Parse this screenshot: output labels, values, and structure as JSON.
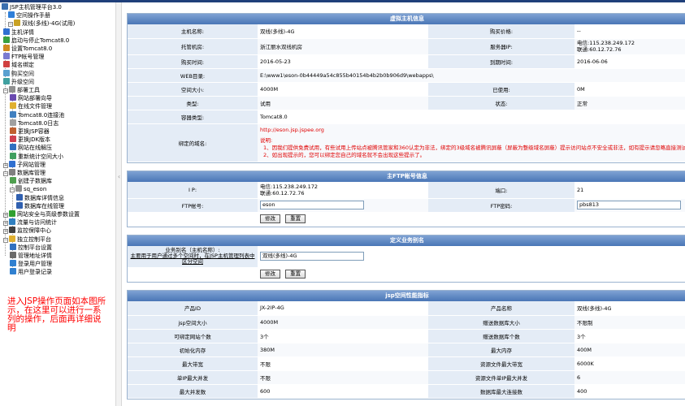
{
  "tree": {
    "items": [
      {
        "label": "JSP主机管理平台3.0",
        "level": 0,
        "icon": "computer-icon",
        "color": "#3a6fb0",
        "exp": ""
      },
      {
        "label": "空间操作手册",
        "level": 1,
        "icon": "book-icon",
        "color": "#2f7fd8",
        "exp": ""
      },
      {
        "label": "双线(多线)-4G(试用)",
        "level": 1,
        "icon": "server-icon",
        "color": "#c9a225",
        "exp": "−"
      },
      {
        "label": "主机详情",
        "level": 2,
        "icon": "info-icon",
        "color": "#2f6fd0",
        "exp": ""
      },
      {
        "label": "启动与停止Tomcat8.0",
        "level": 2,
        "icon": "power-icon",
        "color": "#3aa040",
        "exp": ""
      },
      {
        "label": "设置Tomcat8.0",
        "level": 2,
        "icon": "settings-icon",
        "color": "#d08a20",
        "exp": ""
      },
      {
        "label": "FTP帐号管理",
        "level": 2,
        "icon": "ftp-icon",
        "color": "#7a7ad0",
        "exp": ""
      },
      {
        "label": "域名绑定",
        "level": 2,
        "icon": "globe-icon",
        "color": "#d04040",
        "exp": ""
      },
      {
        "label": "购买空间",
        "level": 2,
        "icon": "cart-icon",
        "color": "#5aa0d0",
        "exp": ""
      },
      {
        "label": "升级空间",
        "level": 2,
        "icon": "upgrade-icon",
        "color": "#40a0a0",
        "exp": ""
      },
      {
        "label": "部署工具",
        "level": 2,
        "icon": "tools-icon",
        "color": "#909090",
        "exp": "−"
      },
      {
        "label": "网站部署向导",
        "level": 3,
        "icon": "wizard-icon",
        "color": "#6a4ab0",
        "exp": ""
      },
      {
        "label": "在线文件管理",
        "level": 3,
        "icon": "folder-icon",
        "color": "#e0b030",
        "exp": ""
      },
      {
        "label": "Tomcat8.0连接池",
        "level": 3,
        "icon": "pool-icon",
        "color": "#4080c0",
        "exp": ""
      },
      {
        "label": "Tomcat8.0日志",
        "level": 3,
        "icon": "log-icon",
        "color": "#a0a0a0",
        "exp": ""
      },
      {
        "label": "更换JSP容器",
        "level": 3,
        "icon": "container-icon",
        "color": "#c06030",
        "exp": ""
      },
      {
        "label": "更换JDK版本",
        "level": 3,
        "icon": "jdk-icon",
        "color": "#d04050",
        "exp": ""
      },
      {
        "label": "网站在线解压",
        "level": 3,
        "icon": "unzip-icon",
        "color": "#3070c0",
        "exp": ""
      },
      {
        "label": "重新统计空间大小",
        "level": 3,
        "icon": "stats-icon",
        "color": "#40a060",
        "exp": ""
      },
      {
        "label": "子网站管理",
        "level": 2,
        "icon": "subsite-icon",
        "color": "#3070d0",
        "exp": "+"
      },
      {
        "label": "数据库管理",
        "level": 2,
        "icon": "database-icon",
        "color": "#808080",
        "exp": "−"
      },
      {
        "label": "创建子数据库",
        "level": 3,
        "icon": "add-db-icon",
        "color": "#50a050",
        "exp": ""
      },
      {
        "label": "sq_eson",
        "level": 3,
        "icon": "db-icon",
        "color": "#909090",
        "exp": "−"
      },
      {
        "label": "数据库详情信息",
        "level": 4,
        "icon": "db-info-icon",
        "color": "#3060b0",
        "exp": ""
      },
      {
        "label": "数据库在线管理",
        "level": 4,
        "icon": "db-manage-icon",
        "color": "#3060b0",
        "exp": ""
      },
      {
        "label": "网站安全与高级参数设置",
        "level": 2,
        "icon": "security-icon",
        "color": "#30a030",
        "exp": "+"
      },
      {
        "label": "流量与访问统计",
        "level": 2,
        "icon": "traffic-icon",
        "color": "#3080c0",
        "exp": "+"
      },
      {
        "label": "监控保障中心",
        "level": 2,
        "icon": "monitor-icon",
        "color": "#404040",
        "exp": "+"
      },
      {
        "label": "独立控制平台",
        "level": 2,
        "icon": "control-icon",
        "color": "#e0b030",
        "exp": "−"
      },
      {
        "label": "控制平台设置",
        "level": 3,
        "icon": "panel-settings-icon",
        "color": "#3070c0",
        "exp": ""
      },
      {
        "label": "管理地址详情",
        "level": 3,
        "icon": "address-icon",
        "color": "#6a6a6a",
        "exp": ""
      },
      {
        "label": "登录用户管理",
        "level": 3,
        "icon": "users-icon",
        "color": "#3080d0",
        "exp": ""
      },
      {
        "label": "用户登录记录",
        "level": 3,
        "icon": "login-log-icon",
        "color": "#3080d0",
        "exp": ""
      }
    ],
    "note": "进入JSP操作页面如本图所示，在这里可以进行一系列的操作，后面再详细说明"
  },
  "vhost": {
    "title": "虚拟主机信息",
    "host_name_label": "主机名称:",
    "host_name": "双线(多线)-4G",
    "price_label": "购买价格:",
    "price": "--",
    "datacenter_label": "托管机房:",
    "datacenter": "浙江丽水双线机房",
    "server_ip_label": "服务器IP:",
    "server_ip_1": "电信:115.238.249.172",
    "server_ip_2": "联通:60.12.72.76",
    "buy_time_label": "购买时间:",
    "buy_time": "2016-05-23",
    "expire_label": "到期时间:",
    "expire": "2016-06-06",
    "web_dir_label": "WEB目录:",
    "web_dir": "E:\\www1\\eson-0b44449a54c855b40154b4b2b0b906d9\\webapps\\",
    "space_label": "空间大小:",
    "space": "4000M",
    "used_label": "已使用:",
    "used": "0M",
    "type_label": "类型:",
    "type": "试用",
    "status_label": "状态:",
    "status": "正常",
    "container_label": "容器类型:",
    "container": "Tomcat8.0",
    "domain_label": "绑定的域名:",
    "domain_value": "http://eson.jsp.jspee.org",
    "domain_note_1": "说明:",
    "domain_note_2": "1、因我们提供免费试用，有些试用上传站点被腾讯管家和360认定为非法，绑定的3级域名被腾讯屏蔽（屏蔽为整级域名屏蔽）提示访问站点不安全或非法，如有提示请忽略直接测试",
    "domain_note_3": "2、如出现提示的，您可以绑定您自己的域名就不会出现这些提示了。"
  },
  "ftp": {
    "title": "主FTP帐号信息",
    "ip_label": "I P:",
    "ip_1": "电信:115.238.249.172",
    "ip_2": "联通:60.12.72.76",
    "port_label": "端口:",
    "port": "21",
    "account_label": "FTP帐号:",
    "account": "eson",
    "password_label": "FTP密码:",
    "password": "pbs813",
    "modify_label": "修改",
    "reset_label": "重置"
  },
  "alias": {
    "title": "定义业务别名",
    "label_1": "业务别名（主机名称）:",
    "label_2": "主要用于用户通过多个空间时，在JSP主机管理列表中区分空间",
    "value": "双线(多线)-4G",
    "modify_label": "修改",
    "reset_label": "重置"
  },
  "perf": {
    "title": "jsp空间性能指标",
    "rows": [
      {
        "l1": "产品ID",
        "v1": "JX-2IP-4G",
        "l2": "产品名称",
        "v2": "双线(多线)-4G"
      },
      {
        "l1": "jsp空间大小",
        "v1": "4000M",
        "l2": "赠送数据库大小",
        "v2": "不限制"
      },
      {
        "l1": "可绑定网站个数",
        "v1": "3个",
        "l2": "赠送数据库个数",
        "v2": "3个"
      },
      {
        "l1": "初始化内存",
        "v1": "380M",
        "l2": "最大内存",
        "v2": "400M"
      },
      {
        "l1": "最大带宽",
        "v1": "不限",
        "l2": "资源文件最大带宽",
        "v2": "6000K"
      },
      {
        "l1": "单IP最大并发",
        "v1": "不限",
        "l2": "资源文件单IP最大并发",
        "v2": "6"
      },
      {
        "l1": "最大并发数",
        "v1": "600",
        "l2": "数据库最大连接数",
        "v2": "400"
      }
    ]
  }
}
